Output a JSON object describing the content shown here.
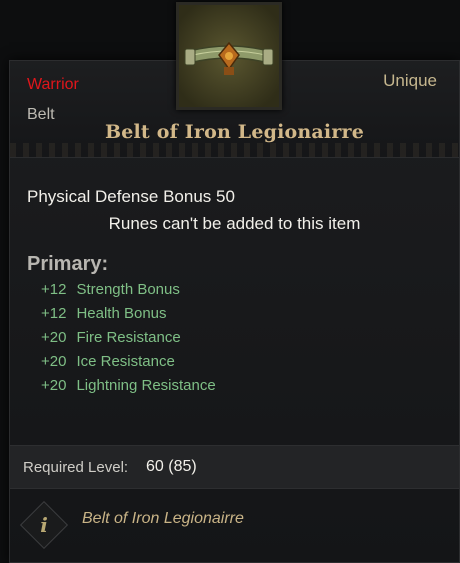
{
  "item": {
    "class_restriction": "Warrior",
    "type": "Belt",
    "rarity": "Unique",
    "name": "Belt of Iron Legionairre",
    "icon": "belt-icon"
  },
  "base_stat": "Physical Defense Bonus 50",
  "runes_note": "Runes can't be added to this item",
  "primary": {
    "title": "Primary:",
    "affixes": [
      {
        "value": "+12",
        "name": "Strength Bonus"
      },
      {
        "value": "+12",
        "name": "Health Bonus"
      },
      {
        "value": "+20",
        "name": "Fire Resistance"
      },
      {
        "value": "+20",
        "name": "Ice Resistance"
      },
      {
        "value": "+20",
        "name": "Lightning Resistance"
      }
    ]
  },
  "requirement": {
    "label": "Required Level:",
    "value": "60 (85)"
  },
  "footer": {
    "icon": "info-icon",
    "glyph": "i",
    "set_name": "Belt of Iron Legionairre"
  },
  "colors": {
    "class_red": "#e0161b",
    "affix_green": "#7fbf86",
    "name_gold": "#d2b889",
    "rarity": "#c5b68e"
  }
}
